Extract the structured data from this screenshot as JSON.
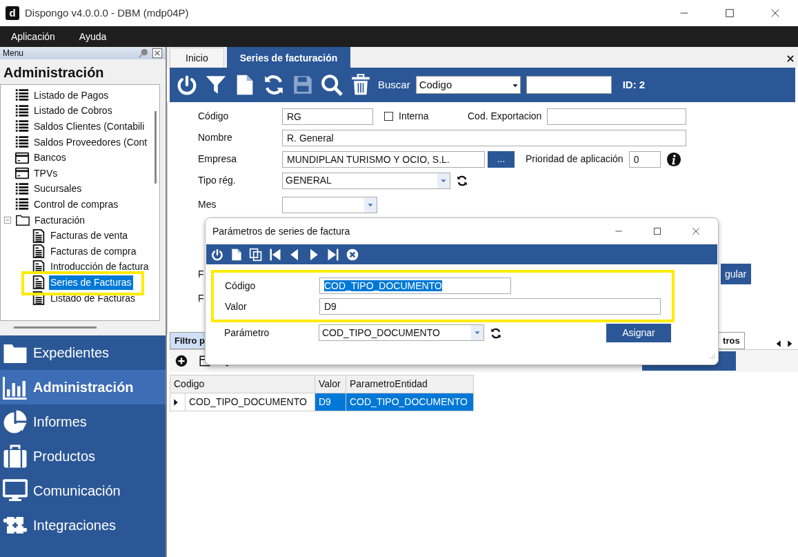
{
  "window": {
    "app_icon": "d",
    "title": "Dispongo v4.0.0.0 - DBM (mdp04P)"
  },
  "menu_bar": [
    "Aplicación",
    "Ayuda"
  ],
  "side_panel": {
    "header": "Menu",
    "section_title": "Administración",
    "tree": [
      {
        "label": "Listado de Pagos",
        "kind": "list",
        "selected": false
      },
      {
        "label": "Listado de Cobros",
        "kind": "list",
        "selected": false
      },
      {
        "label": "Saldos Clientes (Contabili",
        "kind": "list",
        "selected": false
      },
      {
        "label": "Saldos Proveedores (Cont",
        "kind": "list",
        "selected": false
      },
      {
        "label": "Bancos",
        "kind": "card",
        "selected": false
      },
      {
        "label": "TPVs",
        "kind": "card",
        "selected": false
      },
      {
        "label": "Sucursales",
        "kind": "list",
        "selected": false
      },
      {
        "label": "Control de compras",
        "kind": "list",
        "selected": false
      },
      {
        "label": "Facturación",
        "kind": "folder",
        "selected": false,
        "expanded": true,
        "children": [
          {
            "label": "Facturas de venta",
            "kind": "invoice",
            "selected": false
          },
          {
            "label": "Facturas de compra",
            "kind": "invoice",
            "selected": false
          },
          {
            "label": "Introducción de factura",
            "kind": "invoice",
            "selected": false
          },
          {
            "label": "Series de Facturas",
            "kind": "invoice",
            "selected": true
          },
          {
            "label": "Listado de Facturas",
            "kind": "invoice",
            "selected": false
          }
        ]
      }
    ]
  },
  "nav": [
    {
      "label": "Expedientes",
      "kind": "folder",
      "selected": false
    },
    {
      "label": "Administración",
      "kind": "chart",
      "selected": true
    },
    {
      "label": "Informes",
      "kind": "pie",
      "selected": false
    },
    {
      "label": "Productos",
      "kind": "briefcase",
      "selected": false
    },
    {
      "label": "Comunicación",
      "kind": "monitor",
      "selected": false
    },
    {
      "label": "Integraciones",
      "kind": "puzzle",
      "selected": false
    }
  ],
  "tabs": [
    {
      "label": "Inicio",
      "selected": false
    },
    {
      "label": "Series de facturación",
      "selected": true
    }
  ],
  "toolbar": {
    "search_label": "Buscar",
    "search_field": "Codigo",
    "id_label": "ID: 2"
  },
  "form": {
    "codigo": {
      "label": "Código",
      "value": "RG"
    },
    "interna": {
      "label": "Interna",
      "checked": false
    },
    "cod_exportacion": {
      "label": "Cod. Exportacion"
    },
    "nombre": {
      "label": "Nombre",
      "value": "R. General"
    },
    "empresa": {
      "label": "Empresa",
      "value": "MUNDIPLAN TURISMO Y OCIO, S.L.",
      "button": "..."
    },
    "prioridad": {
      "label": "Prioridad de aplicación",
      "value": "0"
    },
    "tipo_reg": {
      "label": "Tipo rég.",
      "value": "GENERAL"
    },
    "mes": {
      "label": "Mes"
    },
    "row_6_label": "F",
    "row_7_label": "F",
    "button_fragment": "gular"
  },
  "bottom": {
    "tabs": [
      {
        "label": "Filtro p",
        "selected": true
      },
      {
        "label": "tros",
        "selected": false
      }
    ],
    "grid": {
      "columns": [
        "Codigo",
        "Valor",
        "ParametroEntidad"
      ],
      "rows": [
        {
          "cells": [
            "COD_TIPO_DOCUMENTO",
            "D9",
            "COD_TIPO_DOCUMENTO"
          ],
          "selected": true
        }
      ]
    }
  },
  "dialog": {
    "title": "Parámetros de series de factura",
    "fields": [
      {
        "label": "Código",
        "value": "COD_TIPO_DOCUMENTO",
        "text_selected": true
      },
      {
        "label": "Valor",
        "value": "D9",
        "text_selected": false
      }
    ],
    "parametro": {
      "label": "Parámetro",
      "value": "COD_TIPO_DOCUMENTO"
    },
    "assign_button": "Asignar"
  }
}
